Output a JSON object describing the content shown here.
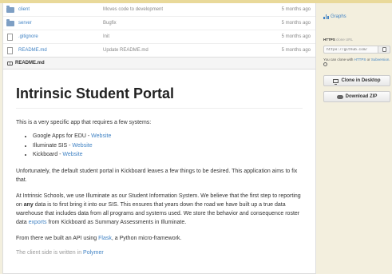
{
  "files": [
    {
      "name": "client",
      "message": "Moves code to development",
      "age": "5 months ago",
      "type": "folder"
    },
    {
      "name": "server",
      "message": "Bugfix",
      "age": "5 months ago",
      "type": "folder"
    },
    {
      "name": ".gitignore",
      "message": "Init",
      "age": "5 months ago",
      "type": "file"
    },
    {
      "name": "README.md",
      "message": "Update README.md",
      "age": "5 months ago",
      "type": "file"
    }
  ],
  "readme": {
    "header_label": "README.md",
    "title": "Intrinsic Student Portal",
    "intro": "This is a very specific app that requires a few systems:",
    "systems": [
      {
        "name": "Google Apps for EDU",
        "sep": " - ",
        "link": "Website"
      },
      {
        "name": "Illuminate SIS",
        "sep": " - ",
        "link": "Website"
      },
      {
        "name": "Kickboard",
        "sep": " - ",
        "link": "Website"
      }
    ],
    "para2": "Unfortunately, the default student portal in Kickboard leaves a few things to be desired. This application aims to fix that.",
    "para3_a": "At Intrinsic Schools, we use Illuminate as our Student Information System. We believe that the first step to reporting on ",
    "para3_bold": "any",
    "para3_b": " data is to first bring it into our SIS. This ensures that years down the road we have built up a true data warehouse that includes data from all programs and systems used. We store the behavior and consequence roster data ",
    "para3_link": "exports",
    "para3_c": " from Kickboard as Summary Assessments in Illuminate.",
    "para4_a": "From there we built an API using ",
    "para4_link": "Flask",
    "para4_b": ", a Python micro-framework.",
    "para5_a": "The client side is written in ",
    "para5_link": "Polymer"
  },
  "sidebar": {
    "graphs_label": "Graphs",
    "clone_label_bold": "HTTPS",
    "clone_label_rest": " clone URL",
    "clone_url": "https://github.com/",
    "clone_note_a": "You can clone with ",
    "clone_note_link1": "HTTPS",
    "clone_note_or": " or ",
    "clone_note_link2": "Subversion",
    "clone_note_end": ".",
    "desktop_button": "Clone in Desktop",
    "zip_button": "Download ZIP"
  },
  "colors": {
    "link": "#4183c4",
    "page_background": "#f3efde",
    "top_accent": "#e9d99a"
  },
  "icons": [
    "folder-icon",
    "file-icon",
    "book-icon",
    "graph-icon",
    "clipboard-icon",
    "help-icon",
    "monitor-icon",
    "cloud-download-icon"
  ]
}
